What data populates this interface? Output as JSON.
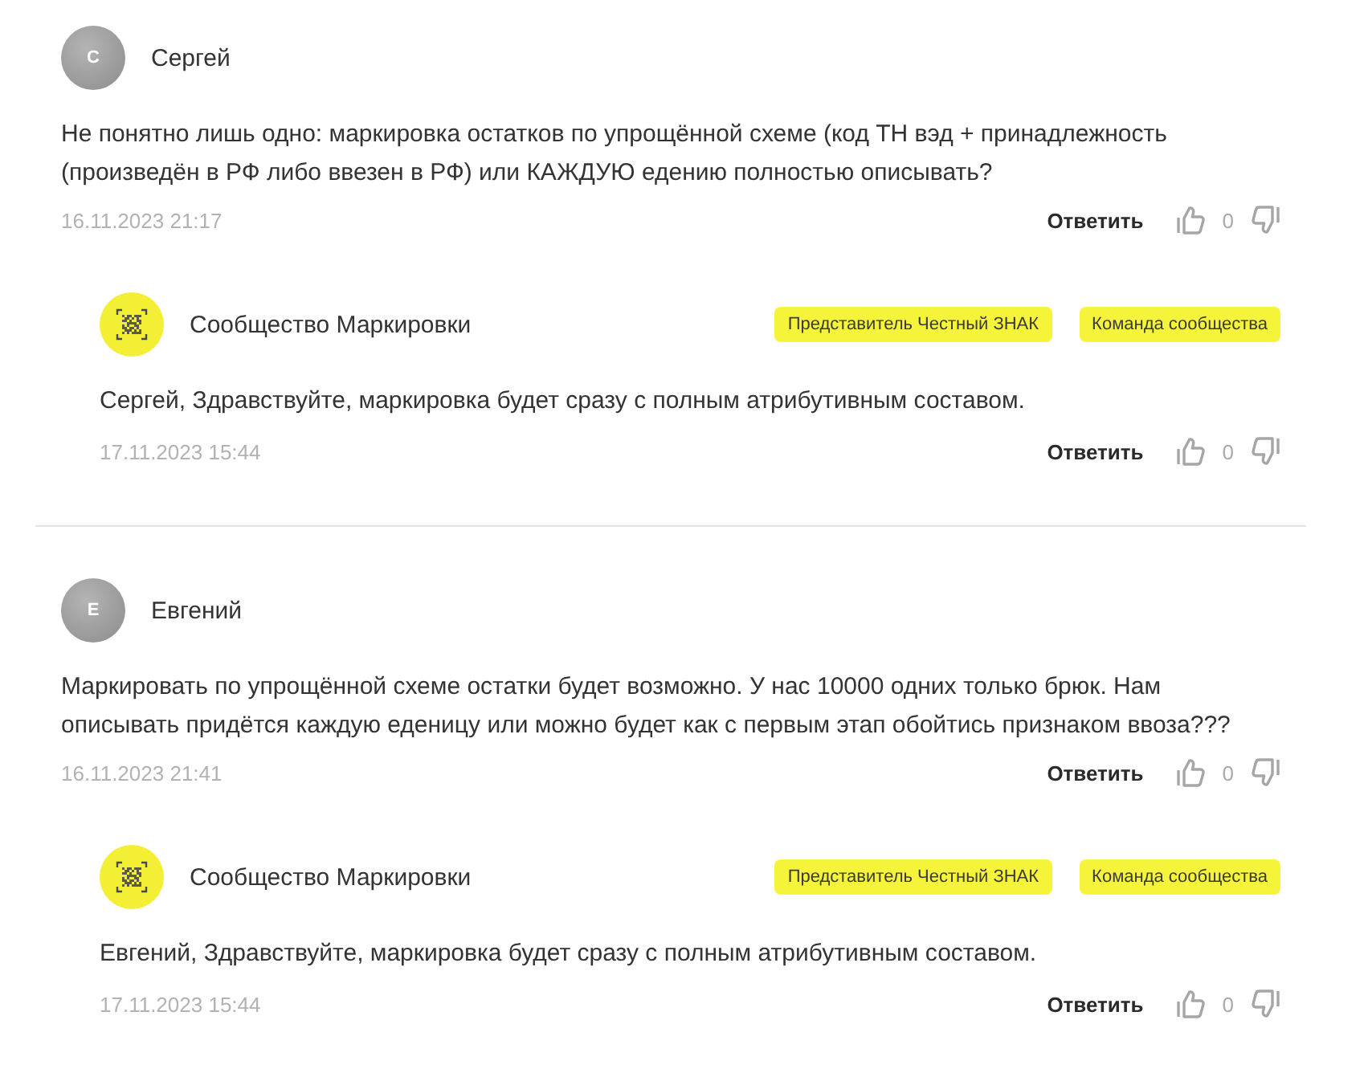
{
  "comments": [
    {
      "author": "Сергей",
      "avatar": {
        "kind": "letter",
        "letter": "С"
      },
      "text": "Не понятно лишь одно: маркировка остатков по упрощённой схеме (код ТН вэд + принадлежность (произведён в РФ либо ввезен в РФ) или КАЖДУЮ едению полностью описывать?",
      "date": "16.11.2023 21:17",
      "reply_label": "Ответить",
      "likes": "0",
      "replies": [
        {
          "author": "Сообщество Маркировки",
          "avatar": {
            "kind": "logo"
          },
          "badges": [
            "Представитель Честный ЗНАК",
            "Команда сообщества"
          ],
          "text": "Сергей, Здравствуйте, маркировка будет сразу с полным атрибутивным составом.",
          "date": "17.11.2023 15:44",
          "reply_label": "Ответить",
          "likes": "0"
        }
      ]
    },
    {
      "author": "Евгений",
      "avatar": {
        "kind": "letter",
        "letter": "Е"
      },
      "text": "Маркировать по упрощённой схеме остатки будет возможно. У нас 10000 одних только брюк. Нам описывать придётся каждую еденицу или можно будет как с первым этап обойтись признаком ввоза???",
      "date": "16.11.2023 21:41",
      "reply_label": "Ответить",
      "likes": "0",
      "replies": [
        {
          "author": "Сообщество Маркировки",
          "avatar": {
            "kind": "logo"
          },
          "badges": [
            "Представитель Честный ЗНАК",
            "Команда сообщества"
          ],
          "text": "Евгений, Здравствуйте, маркировка будет сразу с полным атрибутивным составом.",
          "date": "17.11.2023 15:44",
          "reply_label": "Ответить",
          "likes": "0"
        }
      ]
    }
  ]
}
